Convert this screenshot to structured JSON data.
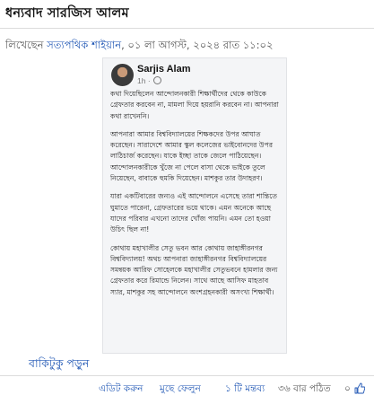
{
  "post": {
    "title": "ধন্যবাদ সারজিস আলম",
    "byline_prefix": "লিখেছেন ",
    "author": "সত্যপথিক শাইয়ান",
    "byline_date": ", ০১ লা আগস্ট, ২০২৪ রাত ১১:০২"
  },
  "embedded_post": {
    "name": "Sarjis Alam",
    "time": "1h ·",
    "paragraphs": [
      "কথা দিয়েছিলেন আন্দোলনকারী শিক্ষার্থীদের থেকে কাউকে গ্রেফতার করবেন না, মামলা দিয়ে হয়রানি করবেন না। আপনারা কথা রাখেননি।",
      "আপনারা আমার বিশ্ববিদ্যালয়ের শিক্ষকদের উপর আঘাত করেছেন। সারাদেশে আমার স্কুল কলেজের ভাইবোনদের উপর লাঠিচার্জ করেছেন। যাকে ইচ্ছা তাকে জেলে পাঠিয়েছেন। আন্দোলনকারীকে খুঁজে না পেলে বাসা থেকে ভাইকে তুলে নিয়েছেন, বাবাকে হুমকি দিয়েছেন। মাশকুর তার উদাহরণ।",
      "যারা একটিবারের জন্যও এই আন্দোলনে এসেছে তারা শান্তিতে ঘুমাতে পারেনা, গ্রেফতারের ভয়ে থাকে। এমন অনেকে আছে যাদের পরিবার এখনো তাদের খোঁজ পায়নি। এমন তো হওয়া উচিৎ ছিল না!",
      "কোথায় মহাখালীর সেতু ভবন আর কোথায় জাহাঙ্গীরনগর বিশ্ববিদ্যালয়! অথচ আপনারা জাহাঙ্গীরনগর বিশ্ববিদ্যালয়ের সমন্বয়ক আরিফ সোহেলকে মহাখালীর সেতুভবনে হামলার জন্য গ্রেফতার করে রিমান্ডে নিলেন। সাথে আছে আসিফ মাহতাব স্যার, মাশকুর সহ আন্দোলনে অংশগ্রহনকারী অসংখ্য শিক্ষার্থী।"
    ]
  },
  "read_more": "বাকিটুকু পড়ুন",
  "footer": {
    "edit": "এডিট করুন",
    "delete": "মুছে ফেলুন",
    "comments": "১ টি মন্তব্য",
    "views": "৩৬ বার পঠিত",
    "likes": "০"
  }
}
